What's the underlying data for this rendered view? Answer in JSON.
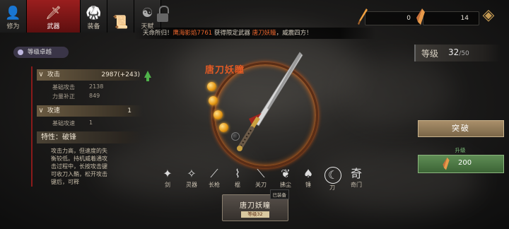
{
  "tabs": [
    {
      "icon": "👤",
      "label": "修为",
      "active": false
    },
    {
      "icon": "🗡",
      "label": "武器",
      "active": true
    },
    {
      "icon": "🥋",
      "label": "装备",
      "active": false
    },
    {
      "icon": "📜",
      "label": "",
      "active": false
    },
    {
      "icon": "☯",
      "label": "天赋",
      "active": false
    }
  ],
  "marquee": {
    "prefix": "天命所归！",
    "player": "鹰海影焰7761",
    "middle": " 获得限定武器 ",
    "item": "唐刀妖瞳",
    "suffix": "，威震四方！"
  },
  "currency": [
    {
      "icon": "sword-shard-icon",
      "value": "0"
    },
    {
      "icon": "crystal-shard-icon",
      "value": "14"
    }
  ],
  "level_pill": "等级卓越",
  "stats": {
    "attack": {
      "label": "攻击",
      "value": "2987(+243)"
    },
    "base_attack": {
      "label": "基础攻击",
      "value": "2138"
    },
    "strength_bonus": {
      "label": "力量补正",
      "value": "849"
    },
    "speed": {
      "label": "攻速",
      "value": "1"
    },
    "base_speed": {
      "label": "基础攻速",
      "value": "1"
    },
    "trait": {
      "label": "特性：破锋"
    },
    "trait_desc": "攻击力高，但速度的失衡较低。持机威着通攻击过程中，长按攻击键可收刀入鞘，松开攻击键后，可释"
  },
  "weapon": {
    "name": "唐刀妖瞳",
    "orbs_filled": 3,
    "orbs_total": 4
  },
  "weapon_types": [
    {
      "icon": "✦",
      "label": "剑",
      "selected": false
    },
    {
      "icon": "✧",
      "label": "灵器",
      "selected": false
    },
    {
      "icon": "⟋",
      "label": "长枪",
      "selected": false
    },
    {
      "icon": "⌇",
      "label": "棍",
      "selected": false
    },
    {
      "icon": "⟍",
      "label": "关刀",
      "selected": false
    },
    {
      "icon": "❦",
      "label": "拂尘",
      "selected": false
    },
    {
      "icon": "♠",
      "label": "锤",
      "selected": false
    },
    {
      "icon": "☾",
      "label": "刀",
      "selected": true
    },
    {
      "icon": "奇",
      "label": "奇门",
      "selected": false
    }
  ],
  "equipped": {
    "tag": "已装备",
    "name": "唐刀妖瞳",
    "level": "等级32"
  },
  "level": {
    "label": "等级",
    "current": "32",
    "max": "/50"
  },
  "breakthrough": "突破",
  "upgrade": {
    "label": "升级",
    "cost": "200"
  }
}
